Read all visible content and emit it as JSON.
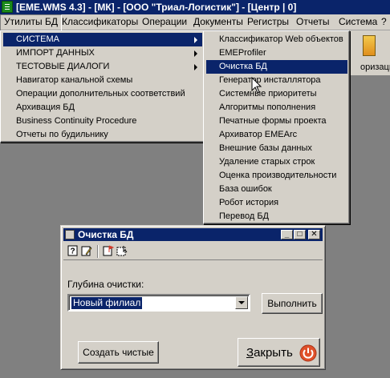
{
  "window": {
    "title": "[EME.WMS 4.3] - [МК] - [ООО \"Триал-Логистик\"] - [Центр | 0]"
  },
  "menubar": {
    "items": [
      "Утилиты БД",
      "Классификаторы",
      "Операции",
      "Документы",
      "Регистры",
      "Отчеты",
      "Система",
      "?"
    ],
    "active_index": 0
  },
  "toolbar": {
    "partial_label": "оризацию"
  },
  "menu_utilities": {
    "items": [
      {
        "label": "СИСТЕМА",
        "submenu": true,
        "highlighted": true
      },
      {
        "label": "ИМПОРТ ДАННЫХ",
        "submenu": true
      },
      {
        "label": "ТЕСТОВЫЕ ДИАЛОГИ",
        "submenu": true
      },
      {
        "label": "Навигатор канальной схемы"
      },
      {
        "label": "Операции дополнительных соответствий"
      },
      {
        "label": "Архивация БД"
      },
      {
        "label": "Business Continuity Procedure"
      },
      {
        "label": "Отчеты по будильнику"
      }
    ]
  },
  "menu_system": {
    "items": [
      {
        "label": "Классификатор Web объектов"
      },
      {
        "label": "EMEProfiler"
      },
      {
        "label": "Очистка БД",
        "highlighted": true
      },
      {
        "label": "Генератор инсталлятора"
      },
      {
        "label": "Системные приоритеты"
      },
      {
        "label": "Алгоритмы пополнения"
      },
      {
        "label": "Печатные формы проекта"
      },
      {
        "label": "Архиватор EMEArc"
      },
      {
        "label": "Внешние базы данных"
      },
      {
        "label": "Удаление старых строк"
      },
      {
        "label": "Оценка производительности"
      },
      {
        "label": "База ошибок"
      },
      {
        "label": "Робот история"
      },
      {
        "label": "Перевод БД"
      }
    ]
  },
  "dialog": {
    "title": "Очистка БД",
    "caption_buttons": [
      "_",
      "□",
      "✕"
    ],
    "depth_label": "Глубина очистки:",
    "depth_value": "Новый филиал",
    "execute_label": "Выполнить",
    "create_clean_label": "Создать чистые",
    "close_label_u": "З",
    "close_label_rest": "акрыть",
    "icons": [
      "help-icon",
      "edit-icon",
      "flag-icon",
      "select-icon",
      "power-icon"
    ]
  },
  "colors": {
    "titlebar": "#0a246a",
    "face": "#d4d0c8",
    "desktop": "#808080",
    "highlight": "#0a246a",
    "power_button": "#e0502a"
  }
}
